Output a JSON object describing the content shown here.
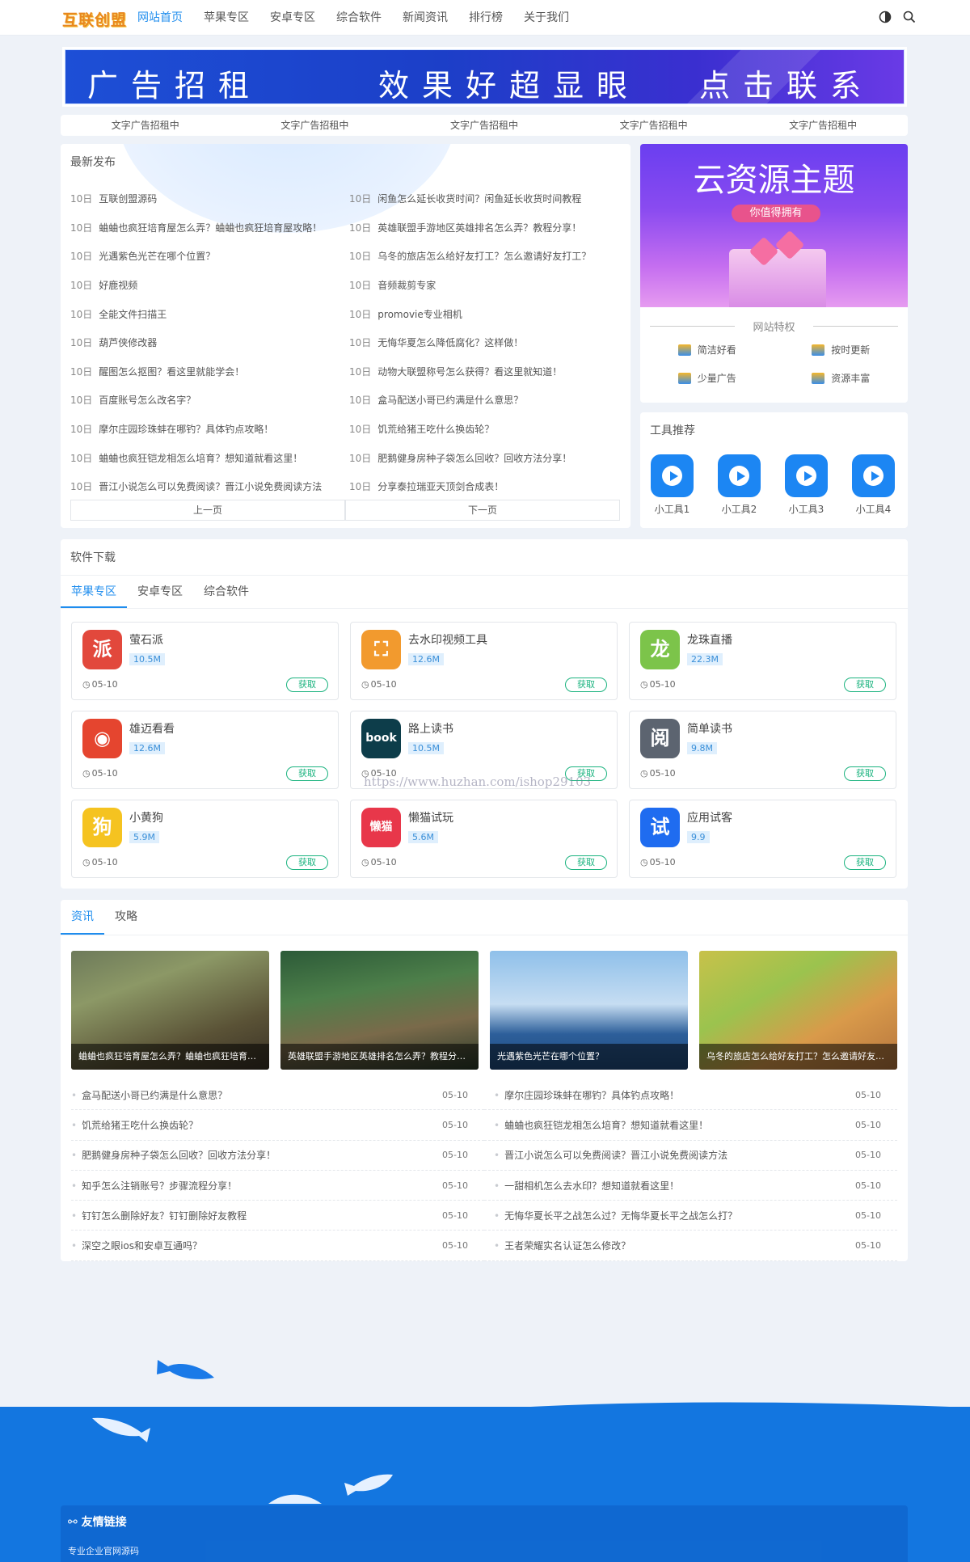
{
  "header": {
    "logo": "互联创盟",
    "nav": [
      "网站首页",
      "苹果专区",
      "安卓专区",
      "综合软件",
      "新闻资讯",
      "排行榜",
      "关于我们"
    ],
    "active_nav": "网站首页",
    "icons": [
      "theme-toggle-icon",
      "search-icon"
    ]
  },
  "banner": {
    "part1": "广告招租",
    "part2": "效果好超显眼",
    "part3": "点击联系"
  },
  "text_ads": [
    "文字广告招租中",
    "文字广告招租中",
    "文字广告招租中",
    "文字广告招租中",
    "文字广告招租中"
  ],
  "latest": {
    "title": "最新发布",
    "items": [
      {
        "d": "10日",
        "t": "互联创盟源码"
      },
      {
        "d": "10日",
        "t": "闲鱼怎么延长收货时间？闲鱼延长收货时间教程"
      },
      {
        "d": "10日",
        "t": "蛐蛐也疯狂培育屋怎么弄？蛐蛐也疯狂培育屋攻略！"
      },
      {
        "d": "10日",
        "t": "英雄联盟手游地区英雄排名怎么弄？教程分享！"
      },
      {
        "d": "10日",
        "t": "光遇紫色光芒在哪个位置？"
      },
      {
        "d": "10日",
        "t": "乌冬的旅店怎么给好友打工？怎么邀请好友打工？"
      },
      {
        "d": "10日",
        "t": "好鹿视频"
      },
      {
        "d": "10日",
        "t": "音频裁剪专家"
      },
      {
        "d": "10日",
        "t": "全能文件扫描王"
      },
      {
        "d": "10日",
        "t": "promovie专业相机"
      },
      {
        "d": "10日",
        "t": "葫芦侠修改器"
      },
      {
        "d": "10日",
        "t": "无悔华夏怎么降低腐化？这样做！"
      },
      {
        "d": "10日",
        "t": "醒图怎么抠图？看这里就能学会！"
      },
      {
        "d": "10日",
        "t": "动物大联盟称号怎么获得？看这里就知道！"
      },
      {
        "d": "10日",
        "t": "百度账号怎么改名字？"
      },
      {
        "d": "10日",
        "t": "盒马配送小哥已约满是什么意思？"
      },
      {
        "d": "10日",
        "t": "摩尔庄园珍珠蚌在哪钓？具体钓点攻略！"
      },
      {
        "d": "10日",
        "t": "饥荒给猪王吃什么换齿轮？"
      },
      {
        "d": "10日",
        "t": "蛐蛐也疯狂铠龙相怎么培育？想知道就看这里！"
      },
      {
        "d": "10日",
        "t": "肥鹅健身房种子袋怎么回收？回收方法分享！"
      },
      {
        "d": "10日",
        "t": "晋江小说怎么可以免费阅读？晋江小说免费阅读方法"
      },
      {
        "d": "10日",
        "t": "分享泰拉瑞亚天顶剑合成表！"
      }
    ],
    "prev": "上一页",
    "next": "下一页"
  },
  "promo": {
    "title": "云资源主题",
    "pill": "你值得拥有",
    "features_title": "网站特权",
    "features": [
      "简洁好看",
      "按时更新",
      "少量广告",
      "资源丰富"
    ]
  },
  "tools": {
    "title": "工具推荐",
    "items": [
      "小工具1",
      "小工具2",
      "小工具3",
      "小工具4"
    ]
  },
  "software": {
    "title": "软件下载",
    "tabs": [
      "苹果专区",
      "安卓专区",
      "综合软件"
    ],
    "active_tab": "苹果专区",
    "get_label": "获取",
    "apps": [
      {
        "name": "萤石派",
        "size": "10.5M",
        "date": "05-10",
        "glyph": "派",
        "color": "#e2483c"
      },
      {
        "name": "去水印视频工具",
        "size": "12.6M",
        "date": "05-10",
        "glyph": "⛶",
        "color": "#f29a2e"
      },
      {
        "name": "龙珠直播",
        "size": "22.3M",
        "date": "05-10",
        "glyph": "龙",
        "color": "#7cc44a"
      },
      {
        "name": "雄迈看看",
        "size": "12.6M",
        "date": "05-10",
        "glyph": "◉",
        "color": "#e5452f"
      },
      {
        "name": "路上读书",
        "size": "10.5M",
        "date": "05-10",
        "glyph": "book",
        "color": "#0d3d4a"
      },
      {
        "name": "简单读书",
        "size": "9.8M",
        "date": "05-10",
        "glyph": "阅",
        "color": "#5c6470"
      },
      {
        "name": "小黄狗",
        "size": "5.9M",
        "date": "05-10",
        "glyph": "狗",
        "color": "#f5c320"
      },
      {
        "name": "懒猫试玩",
        "size": "5.6M",
        "date": "05-10",
        "glyph": "懒猫",
        "color": "#e8374a"
      },
      {
        "name": "应用试客",
        "size": "9.9",
        "date": "05-10",
        "glyph": "试",
        "color": "#1f6cf0"
      }
    ],
    "watermark": "https://www.huzhan.com/ishop29103"
  },
  "news": {
    "tabs": [
      "资讯",
      "攻略"
    ],
    "active_tab": "资讯",
    "featured": [
      {
        "caption": "蛐蛐也疯狂培育屋怎么弄？蛐蛐也疯狂培育屋攻略！"
      },
      {
        "caption": "英雄联盟手游地区英雄排名怎么弄？教程分享！"
      },
      {
        "caption": "光遇紫色光芒在哪个位置？"
      },
      {
        "caption": "乌冬的旅店怎么给好友打工？怎么邀请好友打工？"
      }
    ],
    "items": [
      {
        "t": "盒马配送小哥已约满是什么意思？",
        "d": "05-10"
      },
      {
        "t": "摩尔庄园珍珠蚌在哪钓？具体钓点攻略！",
        "d": "05-10"
      },
      {
        "t": "饥荒给猪王吃什么换齿轮？",
        "d": "05-10"
      },
      {
        "t": "蛐蛐也疯狂铠龙相怎么培育？想知道就看这里！",
        "d": "05-10"
      },
      {
        "t": "肥鹅健身房种子袋怎么回收？回收方法分享！",
        "d": "05-10"
      },
      {
        "t": "晋江小说怎么可以免费阅读？晋江小说免费阅读方法",
        "d": "05-10"
      },
      {
        "t": "知乎怎么注销账号？步骤流程分享！",
        "d": "05-10"
      },
      {
        "t": "一甜相机怎么去水印？想知道就看这里！",
        "d": "05-10"
      },
      {
        "t": "钉钉怎么删除好友？钉钉删除好友教程",
        "d": "05-10"
      },
      {
        "t": "无悔华夏长平之战怎么过？无悔华夏长平之战怎么打？",
        "d": "05-10"
      },
      {
        "t": "深空之眼ios和安卓互通吗？",
        "d": "05-10"
      },
      {
        "t": "王者荣耀实名认证怎么修改？",
        "d": "05-10"
      }
    ]
  },
  "footer": {
    "links_title": "友情链接",
    "links": [
      "专业企业官网源码"
    ]
  }
}
